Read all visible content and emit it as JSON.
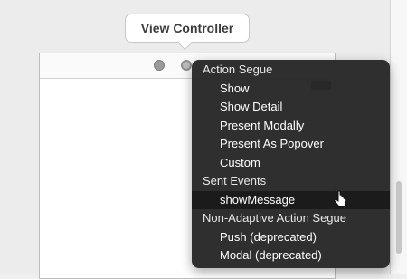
{
  "scene": {
    "title": "View Controller"
  },
  "menu": {
    "sections": [
      {
        "header": "Action Segue",
        "items": [
          "Show",
          "Show Detail",
          "Present Modally",
          "Present As Popover",
          "Custom"
        ]
      },
      {
        "header": "Sent Events",
        "items": [
          "showMessage"
        ]
      },
      {
        "header": "Non-Adaptive Action Segue",
        "items": [
          "Push (deprecated)",
          "Modal (deprecated)"
        ]
      }
    ],
    "selected_item": "showMessage"
  },
  "colors": {
    "menu_background": "#262626",
    "menu_text": "#ffffff",
    "selected_row": "#1b1b1b",
    "canvas": "#ececec"
  },
  "icons": [
    "view-controller-icon",
    "first-responder-icon",
    "exit-icon",
    "pointer-cursor-icon"
  ]
}
